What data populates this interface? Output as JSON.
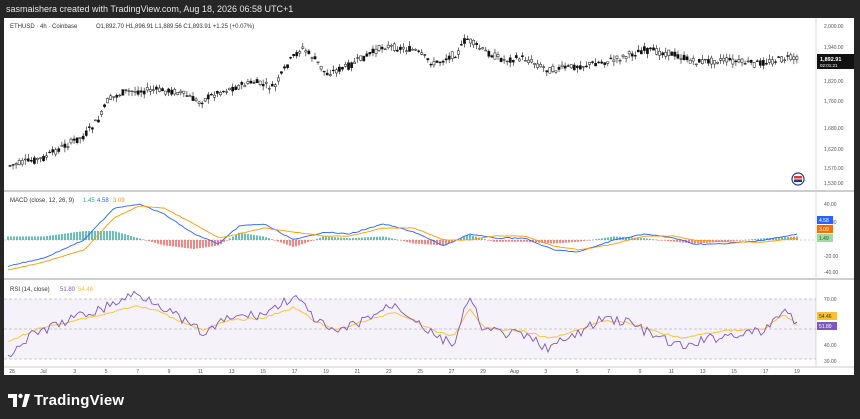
{
  "header": {
    "credit": "sasmaishera created with TradingView.com, Aug 18, 2026 06:58 UTC+1"
  },
  "main_pane": {
    "symbol": "ETHUSD · 4h · Coinbase",
    "ohlc": "O1,892.70  H1,896.91  L1,889.56  C1,893.91  +1.25 (+0.07%)",
    "price_labels": [
      "2,000.00",
      "1,940.00",
      "1,880.00",
      "1,820.00",
      "1,760.00",
      "1,680.00",
      "1,620.00",
      "1,570.00",
      "1,530.00"
    ],
    "last_price": "1,892.91",
    "countdown": "02:01:21"
  },
  "macd_pane": {
    "title": "MACD (close, 12, 26, 9)",
    "values": [
      "1.45",
      "4.58",
      "3.09"
    ],
    "value_colors": [
      "#26a69a",
      "#2962ff",
      "#ff9800"
    ],
    "axis_labels": [
      "40.00",
      "20.00",
      "-20.00",
      "-40.00"
    ],
    "badges": [
      "4.58",
      "3.09",
      "1.49"
    ],
    "badge_colors": [
      "#2962ff",
      "#ff6d00",
      "#a5d6a7"
    ]
  },
  "rsi_pane": {
    "title": "RSI (14, close)",
    "values": [
      "51.80",
      "54.46"
    ],
    "value_colors": [
      "#7e57c2",
      "#fbc02d"
    ],
    "axis_labels": [
      "70.00",
      "40.00",
      "30.00"
    ],
    "badges": [
      "54.46",
      "51.80"
    ],
    "badge_colors": [
      "#fbc02d",
      "#7e57c2"
    ]
  },
  "time_axis": [
    "28",
    "Jul",
    "3",
    "5",
    "7",
    "9",
    "11",
    "13",
    "15",
    "17",
    "19",
    "21",
    "23",
    "25",
    "27",
    "29",
    "Aug",
    "3",
    "5",
    "7",
    "9",
    "11",
    "13",
    "15",
    "17",
    "19"
  ],
  "footer": {
    "brand": "TradingView"
  },
  "colors": {
    "up": "#ffffff",
    "down": "#000000",
    "macd": "#2962ff",
    "signal": "#ff9800",
    "rsi": "#7e57c2",
    "rsi_ma": "#fbc02d",
    "hist_pos": "#26a69a",
    "hist_neg": "#ef5350"
  }
}
